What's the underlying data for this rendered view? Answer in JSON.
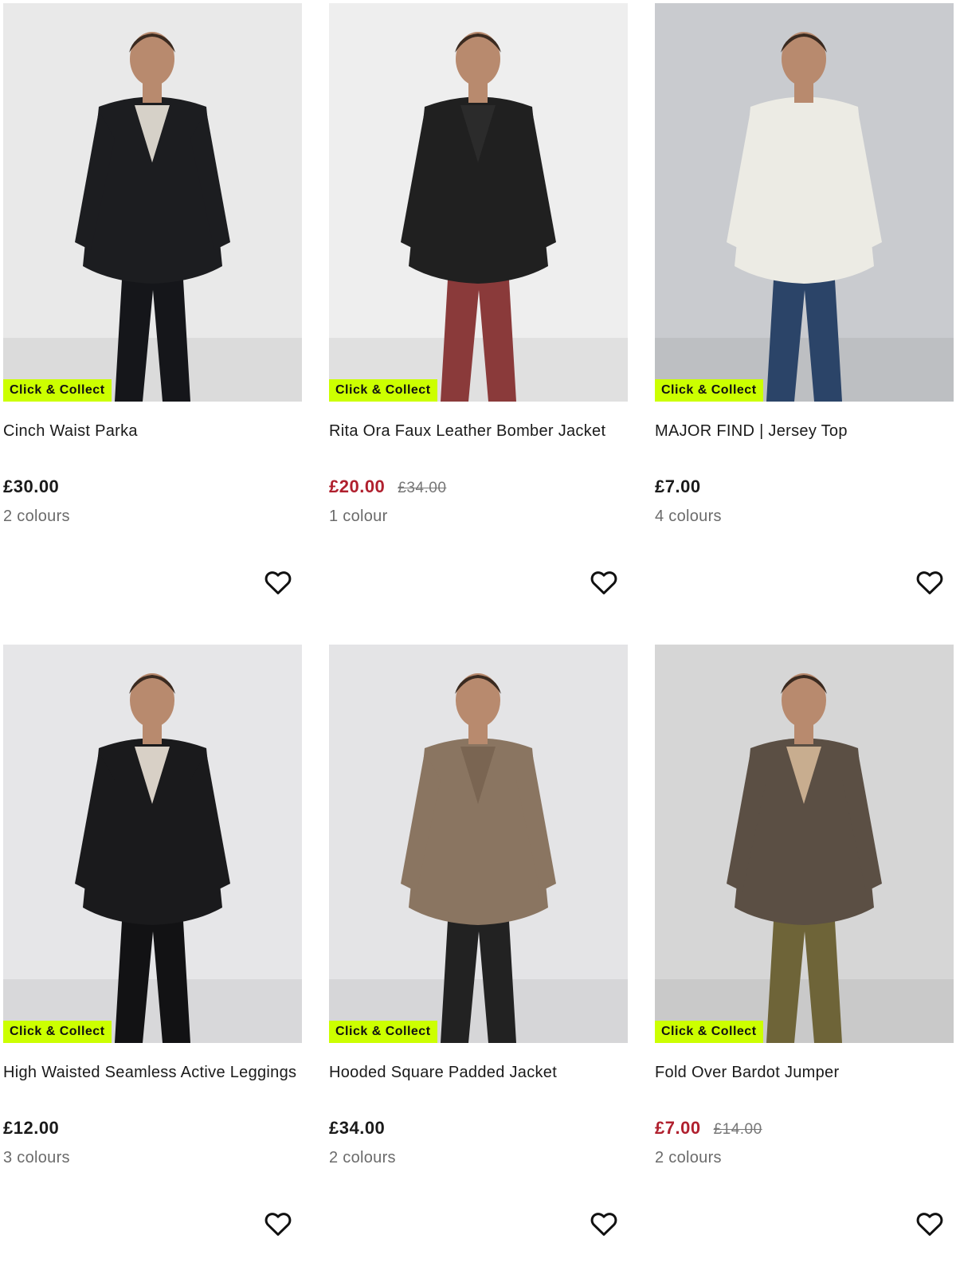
{
  "products": [
    {
      "name": "Cinch Waist Parka",
      "badge": "Click & Collect",
      "price": "£30.00",
      "was_price": "",
      "on_sale": false,
      "colours": "2 colours",
      "image_icon": "model-black-parka-image",
      "bg": "#e9e9e9",
      "main": "#1c1d20",
      "accent": "#d6d1c8",
      "legs": "#15161a"
    },
    {
      "name": "Rita Ora Faux Leather Bomber Jacket",
      "badge": "Click & Collect",
      "price": "£20.00",
      "was_price": "£34.00",
      "on_sale": true,
      "colours": "1 colour",
      "image_icon": "model-leather-jacket-image",
      "bg": "#eeeeee",
      "main": "#202020",
      "accent": "#2b2b2b",
      "legs": "#8a3a3a"
    },
    {
      "name": "MAJOR FIND | Jersey Top",
      "badge": "Click & Collect",
      "price": "£7.00",
      "was_price": "",
      "on_sale": false,
      "colours": "4 colours",
      "image_icon": "model-white-top-image",
      "bg": "#c9cbcf",
      "main": "#ecebe4",
      "accent": "#ecebe4",
      "legs": "#2b4468"
    },
    {
      "name": "High Waisted Seamless Active Leggings",
      "badge": "Click & Collect",
      "price": "£12.00",
      "was_price": "",
      "on_sale": false,
      "colours": "3 colours",
      "image_icon": "model-black-leggings-image",
      "bg": "#e6e6e8",
      "main": "#1a1a1c",
      "accent": "#d8d0c6",
      "legs": "#121214"
    },
    {
      "name": "Hooded Square Padded Jacket",
      "badge": "Click & Collect",
      "price": "£34.00",
      "was_price": "",
      "on_sale": false,
      "colours": "2 colours",
      "image_icon": "model-padded-jacket-image",
      "bg": "#e4e4e6",
      "main": "#8a7561",
      "accent": "#7a6552",
      "legs": "#222222"
    },
    {
      "name": "Fold Over Bardot Jumper",
      "badge": "Click & Collect",
      "price": "£7.00",
      "was_price": "£14.00",
      "on_sale": true,
      "colours": "2 colours",
      "image_icon": "model-bardot-jumper-image",
      "bg": "#d6d6d6",
      "main": "#5b4f44",
      "accent": "#c8ad8f",
      "legs": "#6e6438"
    }
  ],
  "icons": {
    "wishlist": "heart-outline-icon"
  },
  "colors": {
    "badge_bg": "#ccff00",
    "sale_price": "#b0202e"
  }
}
